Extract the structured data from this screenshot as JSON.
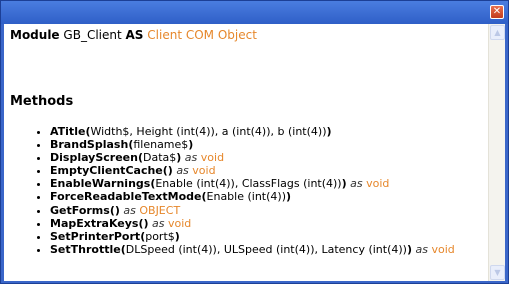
{
  "window": {
    "close_glyph": "✕"
  },
  "module": {
    "keyword_module": "Module",
    "name": "GB_Client",
    "keyword_as": "AS",
    "type": "Client COM Object"
  },
  "section": {
    "title": "Methods"
  },
  "methods": [
    {
      "name": "ATitle",
      "open": "(",
      "params": "Width$, Height (int(4)), a (int(4)), b (int(4))",
      "close": ")",
      "as": "",
      "return_type": ""
    },
    {
      "name": "BrandSplash",
      "open": "(",
      "params": "filename$",
      "close": ")",
      "as": "",
      "return_type": ""
    },
    {
      "name": "DisplayScreen",
      "open": "(",
      "params": "Data$",
      "close": ")",
      "as": "as",
      "return_type": "void"
    },
    {
      "name": "EmptyClientCache",
      "open": "(",
      "params": "",
      "close": ")",
      "as": "as",
      "return_type": "void"
    },
    {
      "name": "EnableWarnings",
      "open": "(",
      "params": "Enable (int(4)), ClassFlags (int(4))",
      "close": ")",
      "as": "as",
      "return_type": "void"
    },
    {
      "name": "ForceReadableTextMode",
      "open": "(",
      "params": "Enable (int(4))",
      "close": ")",
      "as": "",
      "return_type": ""
    },
    {
      "name": "GetForms",
      "open": "(",
      "params": "",
      "close": ")",
      "as": "as",
      "return_type": "OBJECT"
    },
    {
      "name": "MapExtraKeys",
      "open": "(",
      "params": "",
      "close": ")",
      "as": "as",
      "return_type": "void"
    },
    {
      "name": "SetPrinterPort",
      "open": "(",
      "params": "port$",
      "close": ")",
      "as": "",
      "return_type": ""
    },
    {
      "name": "SetThrottle",
      "open": "(",
      "params": "DLSpeed (int(4)), ULSpeed (int(4)), Latency (int(4))",
      "close": ")",
      "as": "as",
      "return_type": "void"
    }
  ],
  "colors": {
    "accent": "#e6872b",
    "titlebar": "#2f5fc7"
  }
}
